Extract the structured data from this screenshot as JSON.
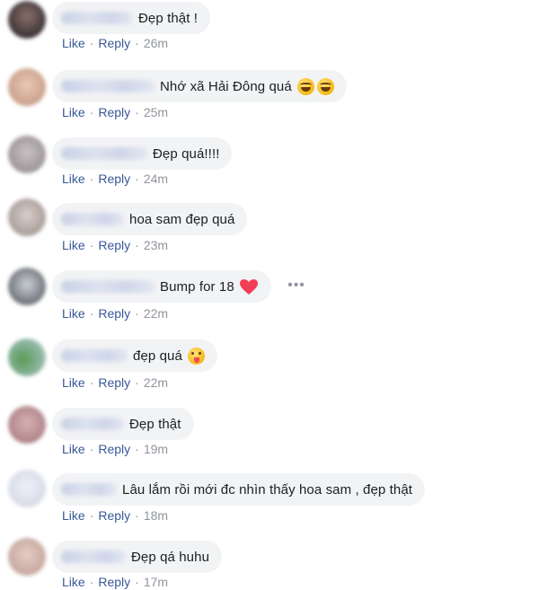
{
  "comments": [
    {
      "text": "Đẹp thật !",
      "like": "Like",
      "reply": "Reply",
      "time": "26m"
    },
    {
      "text": "Nhớ xã Hải Đông quá",
      "emoji_1": "laugh-cry-emoji",
      "emoji_2": "laugh-cry-emoji",
      "like": "Like",
      "reply": "Reply",
      "time": "25m"
    },
    {
      "text": "Đẹp quá!!!!",
      "like": "Like",
      "reply": "Reply",
      "time": "24m"
    },
    {
      "text": "hoa sam đẹp quá",
      "like": "Like",
      "reply": "Reply",
      "time": "23m"
    },
    {
      "text": "Bump for 18",
      "emoji_1": "heart-emoji",
      "more": "•••",
      "like": "Like",
      "reply": "Reply",
      "time": "22m"
    },
    {
      "text": "đẹp quá",
      "emoji_1": "tongue-wink-emoji",
      "like": "Like",
      "reply": "Reply",
      "time": "22m"
    },
    {
      "text": "Đẹp thật",
      "like": "Like",
      "reply": "Reply",
      "time": "19m"
    },
    {
      "text": "Lâu lắm rồi mới đc nhìn thấy hoa sam , đẹp thật",
      "like": "Like",
      "reply": "Reply",
      "time": "18m"
    },
    {
      "text": "Đẹp qá huhu",
      "like": "Like",
      "reply": "Reply",
      "time": "17m"
    }
  ],
  "colors": {
    "bubble": "#f2f3f5",
    "link": "#385898",
    "meta": "#90949c",
    "heart": "#f33e58"
  }
}
